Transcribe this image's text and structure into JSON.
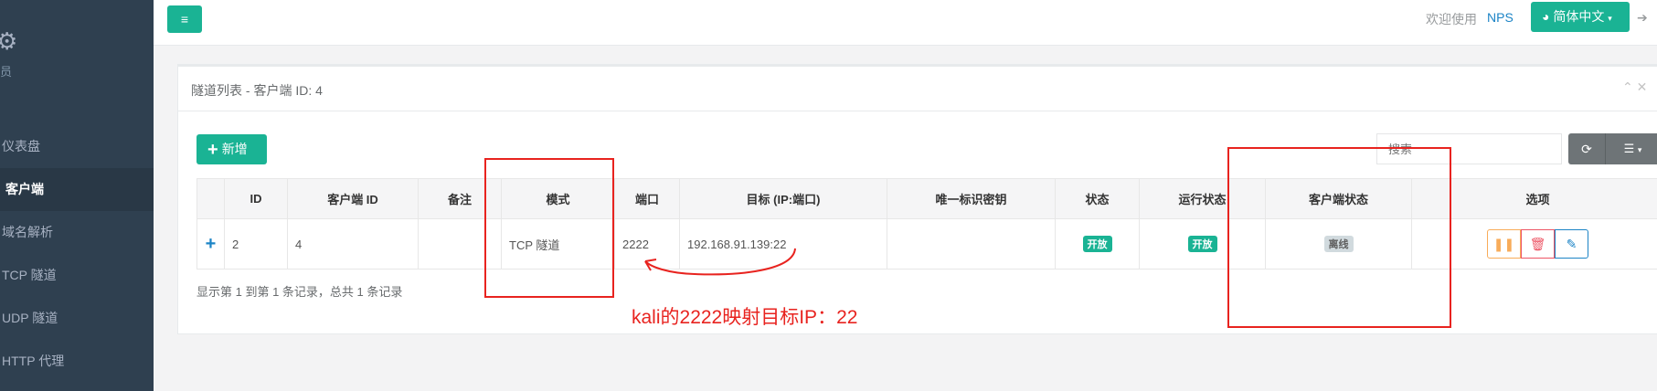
{
  "sidebar": {
    "gear_icon": "gear-icon",
    "user_partial": "员",
    "items": [
      {
        "label": "仪表盘"
      },
      {
        "label": "客户端"
      },
      {
        "label": "域名解析"
      },
      {
        "label": "TCP 隧道"
      },
      {
        "label": "UDP 隧道"
      },
      {
        "label": "HTTP 代理"
      }
    ]
  },
  "topbar": {
    "menu_icon": "≡",
    "welcome": "欢迎使用",
    "nps": "NPS",
    "language": "简体中文",
    "logout_partial": "➔"
  },
  "panel": {
    "title": "隧道列表 - 客户端 ID: 4",
    "tools": "⌃ ✕",
    "add_label": "新增",
    "search_placeholder": "搜索",
    "columns": [
      "ID",
      "客户端 ID",
      "备注",
      "模式",
      "端口",
      "目标 (IP:端口)",
      "唯一标识密钥",
      "状态",
      "运行状态",
      "客户端状态",
      "选项"
    ],
    "row": {
      "expand": "+",
      "id": "2",
      "client_id": "4",
      "remark": "",
      "mode": "TCP 隧道",
      "port": "2222",
      "target": "192.168.91.139:22",
      "key": "",
      "status": "开放",
      "run_status": "开放",
      "client_status": "离线"
    },
    "footer": "显示第 1 到第 1 条记录，总共 1 条记录"
  },
  "annotation": {
    "text": "kali的2222映射目标IP：22",
    "color": "#e8231f"
  }
}
